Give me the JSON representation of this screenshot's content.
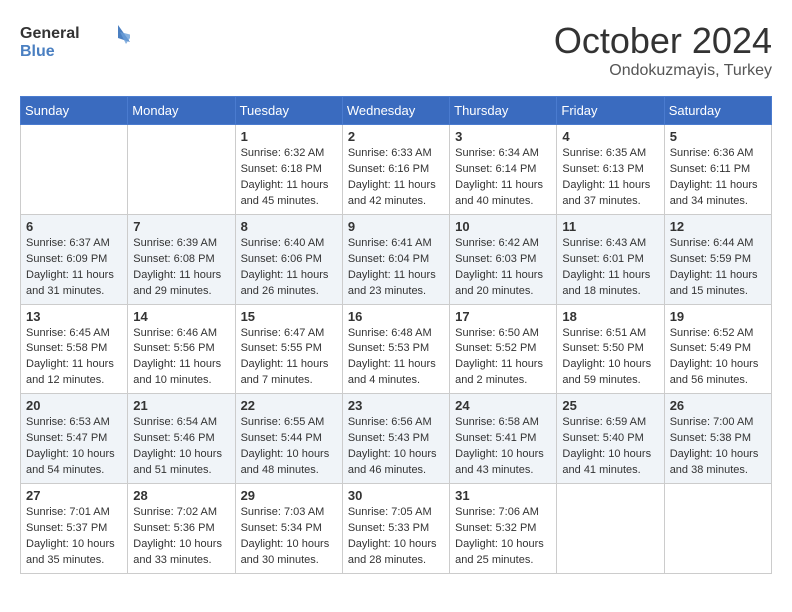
{
  "header": {
    "logo_general": "General",
    "logo_blue": "Blue",
    "month_title": "October 2024",
    "location": "Ondokuzmayis, Turkey"
  },
  "weekdays": [
    "Sunday",
    "Monday",
    "Tuesday",
    "Wednesday",
    "Thursday",
    "Friday",
    "Saturday"
  ],
  "weeks": [
    [
      {
        "day": "",
        "sunrise": "",
        "sunset": "",
        "daylight": ""
      },
      {
        "day": "",
        "sunrise": "",
        "sunset": "",
        "daylight": ""
      },
      {
        "day": "1",
        "sunrise": "Sunrise: 6:32 AM",
        "sunset": "Sunset: 6:18 PM",
        "daylight": "Daylight: 11 hours and 45 minutes."
      },
      {
        "day": "2",
        "sunrise": "Sunrise: 6:33 AM",
        "sunset": "Sunset: 6:16 PM",
        "daylight": "Daylight: 11 hours and 42 minutes."
      },
      {
        "day": "3",
        "sunrise": "Sunrise: 6:34 AM",
        "sunset": "Sunset: 6:14 PM",
        "daylight": "Daylight: 11 hours and 40 minutes."
      },
      {
        "day": "4",
        "sunrise": "Sunrise: 6:35 AM",
        "sunset": "Sunset: 6:13 PM",
        "daylight": "Daylight: 11 hours and 37 minutes."
      },
      {
        "day": "5",
        "sunrise": "Sunrise: 6:36 AM",
        "sunset": "Sunset: 6:11 PM",
        "daylight": "Daylight: 11 hours and 34 minutes."
      }
    ],
    [
      {
        "day": "6",
        "sunrise": "Sunrise: 6:37 AM",
        "sunset": "Sunset: 6:09 PM",
        "daylight": "Daylight: 11 hours and 31 minutes."
      },
      {
        "day": "7",
        "sunrise": "Sunrise: 6:39 AM",
        "sunset": "Sunset: 6:08 PM",
        "daylight": "Daylight: 11 hours and 29 minutes."
      },
      {
        "day": "8",
        "sunrise": "Sunrise: 6:40 AM",
        "sunset": "Sunset: 6:06 PM",
        "daylight": "Daylight: 11 hours and 26 minutes."
      },
      {
        "day": "9",
        "sunrise": "Sunrise: 6:41 AM",
        "sunset": "Sunset: 6:04 PM",
        "daylight": "Daylight: 11 hours and 23 minutes."
      },
      {
        "day": "10",
        "sunrise": "Sunrise: 6:42 AM",
        "sunset": "Sunset: 6:03 PM",
        "daylight": "Daylight: 11 hours and 20 minutes."
      },
      {
        "day": "11",
        "sunrise": "Sunrise: 6:43 AM",
        "sunset": "Sunset: 6:01 PM",
        "daylight": "Daylight: 11 hours and 18 minutes."
      },
      {
        "day": "12",
        "sunrise": "Sunrise: 6:44 AM",
        "sunset": "Sunset: 5:59 PM",
        "daylight": "Daylight: 11 hours and 15 minutes."
      }
    ],
    [
      {
        "day": "13",
        "sunrise": "Sunrise: 6:45 AM",
        "sunset": "Sunset: 5:58 PM",
        "daylight": "Daylight: 11 hours and 12 minutes."
      },
      {
        "day": "14",
        "sunrise": "Sunrise: 6:46 AM",
        "sunset": "Sunset: 5:56 PM",
        "daylight": "Daylight: 11 hours and 10 minutes."
      },
      {
        "day": "15",
        "sunrise": "Sunrise: 6:47 AM",
        "sunset": "Sunset: 5:55 PM",
        "daylight": "Daylight: 11 hours and 7 minutes."
      },
      {
        "day": "16",
        "sunrise": "Sunrise: 6:48 AM",
        "sunset": "Sunset: 5:53 PM",
        "daylight": "Daylight: 11 hours and 4 minutes."
      },
      {
        "day": "17",
        "sunrise": "Sunrise: 6:50 AM",
        "sunset": "Sunset: 5:52 PM",
        "daylight": "Daylight: 11 hours and 2 minutes."
      },
      {
        "day": "18",
        "sunrise": "Sunrise: 6:51 AM",
        "sunset": "Sunset: 5:50 PM",
        "daylight": "Daylight: 10 hours and 59 minutes."
      },
      {
        "day": "19",
        "sunrise": "Sunrise: 6:52 AM",
        "sunset": "Sunset: 5:49 PM",
        "daylight": "Daylight: 10 hours and 56 minutes."
      }
    ],
    [
      {
        "day": "20",
        "sunrise": "Sunrise: 6:53 AM",
        "sunset": "Sunset: 5:47 PM",
        "daylight": "Daylight: 10 hours and 54 minutes."
      },
      {
        "day": "21",
        "sunrise": "Sunrise: 6:54 AM",
        "sunset": "Sunset: 5:46 PM",
        "daylight": "Daylight: 10 hours and 51 minutes."
      },
      {
        "day": "22",
        "sunrise": "Sunrise: 6:55 AM",
        "sunset": "Sunset: 5:44 PM",
        "daylight": "Daylight: 10 hours and 48 minutes."
      },
      {
        "day": "23",
        "sunrise": "Sunrise: 6:56 AM",
        "sunset": "Sunset: 5:43 PM",
        "daylight": "Daylight: 10 hours and 46 minutes."
      },
      {
        "day": "24",
        "sunrise": "Sunrise: 6:58 AM",
        "sunset": "Sunset: 5:41 PM",
        "daylight": "Daylight: 10 hours and 43 minutes."
      },
      {
        "day": "25",
        "sunrise": "Sunrise: 6:59 AM",
        "sunset": "Sunset: 5:40 PM",
        "daylight": "Daylight: 10 hours and 41 minutes."
      },
      {
        "day": "26",
        "sunrise": "Sunrise: 7:00 AM",
        "sunset": "Sunset: 5:38 PM",
        "daylight": "Daylight: 10 hours and 38 minutes."
      }
    ],
    [
      {
        "day": "27",
        "sunrise": "Sunrise: 7:01 AM",
        "sunset": "Sunset: 5:37 PM",
        "daylight": "Daylight: 10 hours and 35 minutes."
      },
      {
        "day": "28",
        "sunrise": "Sunrise: 7:02 AM",
        "sunset": "Sunset: 5:36 PM",
        "daylight": "Daylight: 10 hours and 33 minutes."
      },
      {
        "day": "29",
        "sunrise": "Sunrise: 7:03 AM",
        "sunset": "Sunset: 5:34 PM",
        "daylight": "Daylight: 10 hours and 30 minutes."
      },
      {
        "day": "30",
        "sunrise": "Sunrise: 7:05 AM",
        "sunset": "Sunset: 5:33 PM",
        "daylight": "Daylight: 10 hours and 28 minutes."
      },
      {
        "day": "31",
        "sunrise": "Sunrise: 7:06 AM",
        "sunset": "Sunset: 5:32 PM",
        "daylight": "Daylight: 10 hours and 25 minutes."
      },
      {
        "day": "",
        "sunrise": "",
        "sunset": "",
        "daylight": ""
      },
      {
        "day": "",
        "sunrise": "",
        "sunset": "",
        "daylight": ""
      }
    ]
  ]
}
